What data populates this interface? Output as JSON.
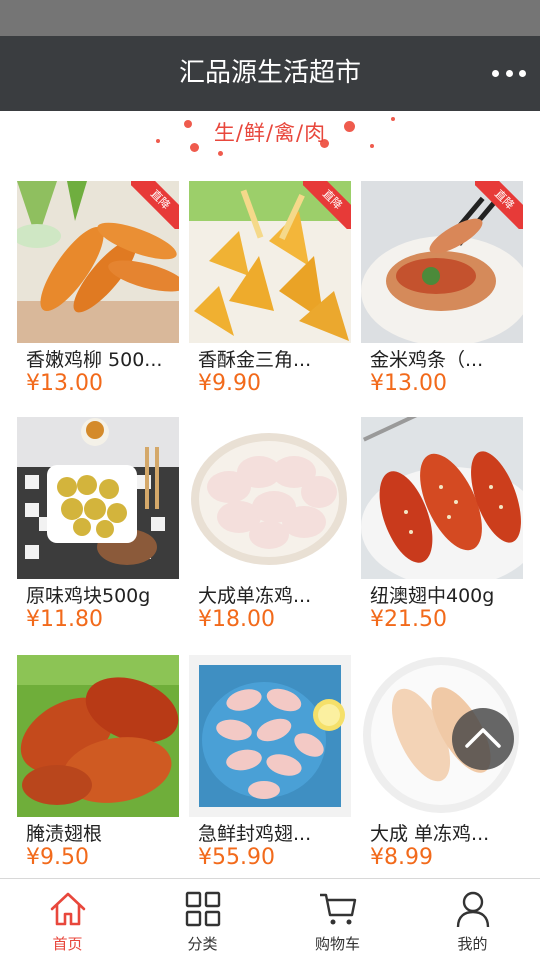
{
  "header": {
    "title": "汇品源生活超市",
    "more_icon": "more-dots-icon"
  },
  "section": {
    "title_chars": [
      "生",
      "鲜",
      "禽",
      "肉"
    ],
    "separator": "/"
  },
  "badge_label": "直降",
  "products": [
    {
      "name": "香嫩鸡柳 500...",
      "price": "¥13.00",
      "badge": true
    },
    {
      "name": "香酥金三角...",
      "price": "¥9.90",
      "badge": true
    },
    {
      "name": "金米鸡条（...",
      "price": "¥13.00",
      "badge": true
    },
    {
      "name": "原味鸡块500g",
      "price": "¥11.80",
      "badge": false
    },
    {
      "name": "大成单冻鸡...",
      "price": "¥18.00",
      "badge": false
    },
    {
      "name": "纽澳翅中400g",
      "price": "¥21.50",
      "badge": false
    },
    {
      "name": "腌渍翅根",
      "price": "¥9.50",
      "badge": false
    },
    {
      "name": "急鲜封鸡翅...",
      "price": "¥55.90",
      "badge": false
    },
    {
      "name": "大成 单冻鸡...",
      "price": "¥8.99",
      "badge": false
    }
  ],
  "tabbar": {
    "items": [
      {
        "label": "首页",
        "icon": "home-icon",
        "active": true
      },
      {
        "label": "分类",
        "icon": "category-grid-icon",
        "active": false
      },
      {
        "label": "购物车",
        "icon": "shopping-cart-icon",
        "active": false
      },
      {
        "label": "我的",
        "icon": "user-profile-icon",
        "active": false
      }
    ]
  },
  "colors": {
    "header_bg": "#3a3d40",
    "accent_red": "#e8473c",
    "price_orange": "#f26a1b"
  }
}
